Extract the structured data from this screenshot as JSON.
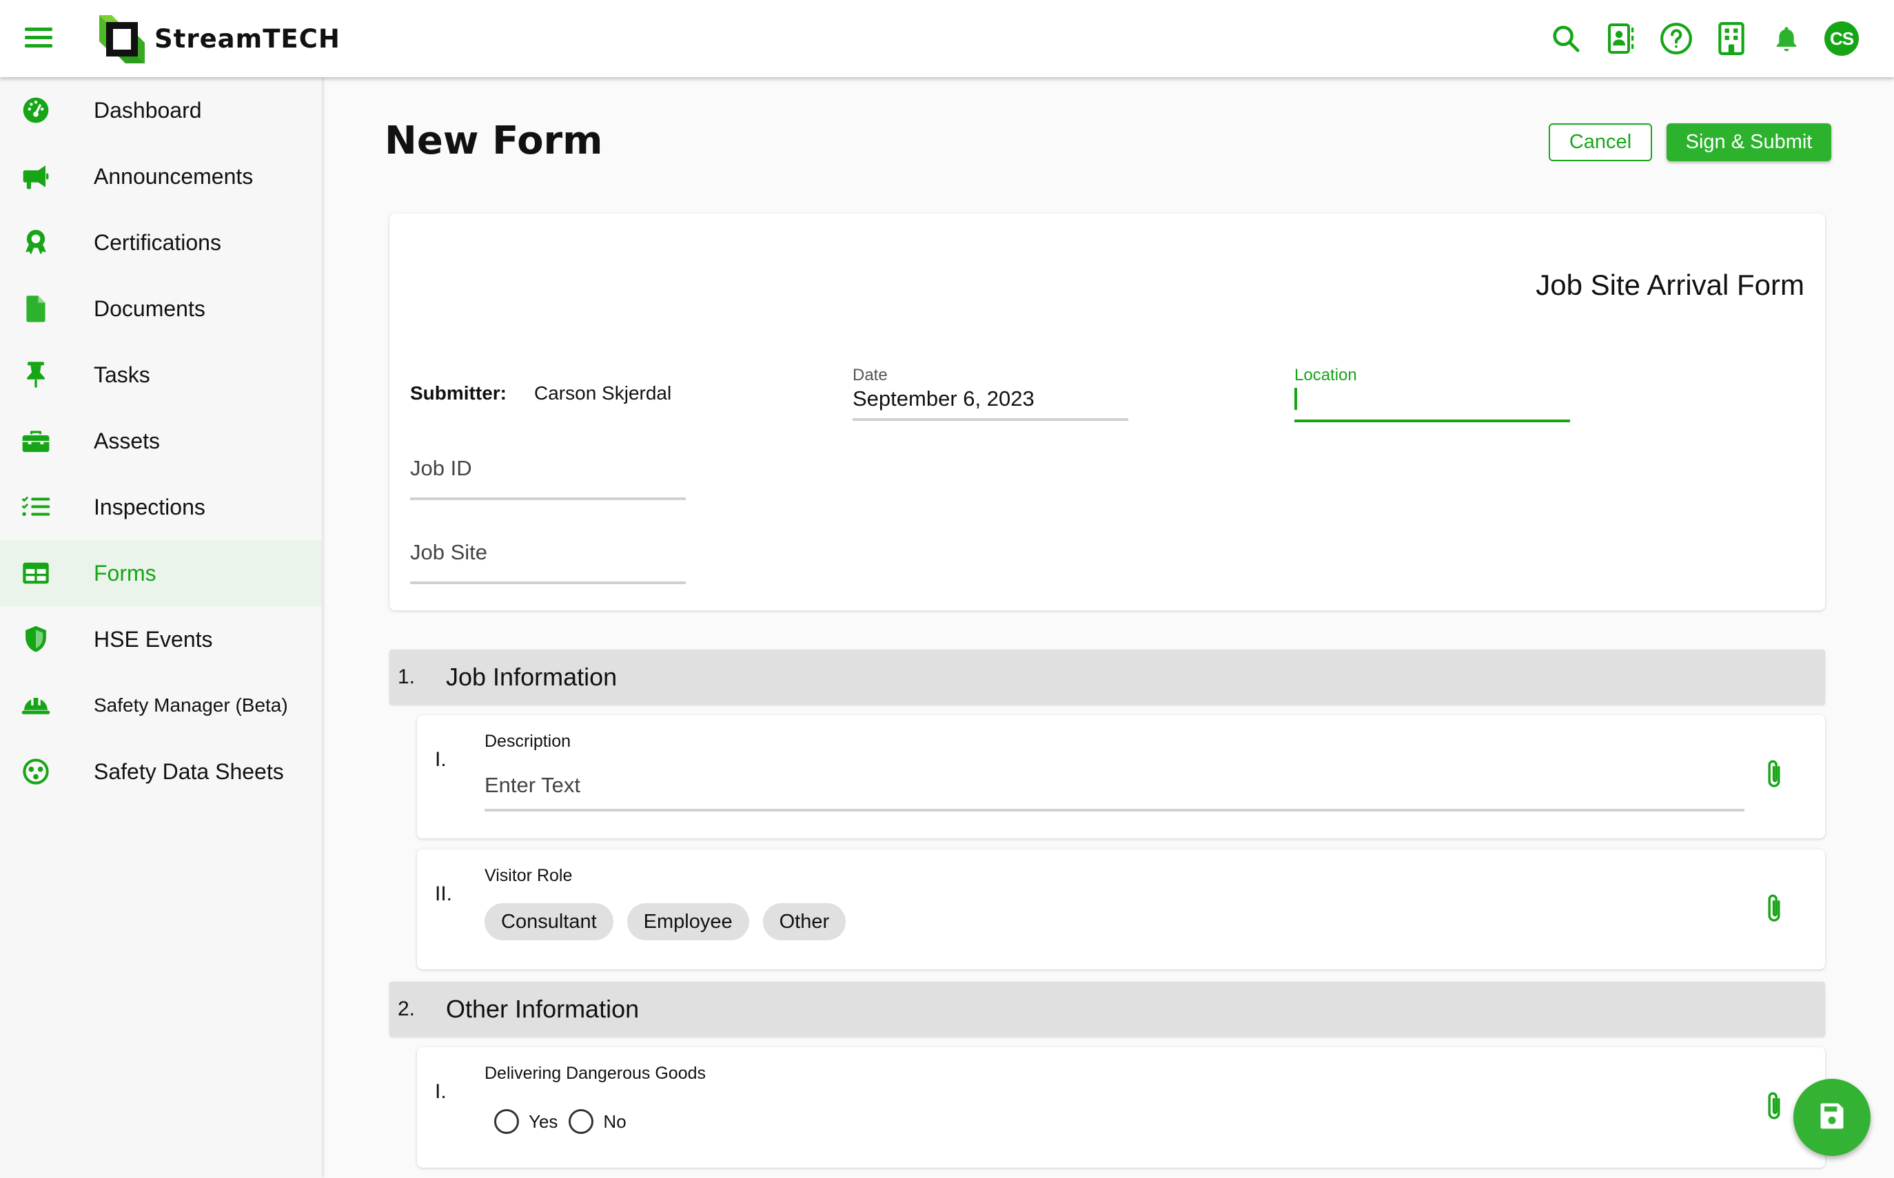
{
  "app": {
    "brand": "StreamTECH",
    "accent": "#16a516"
  },
  "header": {
    "icons": [
      "search-icon",
      "contacts-icon",
      "help-icon",
      "building-icon",
      "bell-icon"
    ],
    "avatar_initials": "CS"
  },
  "sidebar": {
    "items": [
      {
        "label": "Dashboard",
        "icon": "dashboard-icon",
        "active": false
      },
      {
        "label": "Announcements",
        "icon": "megaphone-icon",
        "active": false
      },
      {
        "label": "Certifications",
        "icon": "award-icon",
        "active": false
      },
      {
        "label": "Documents",
        "icon": "document-icon",
        "active": false
      },
      {
        "label": "Tasks",
        "icon": "pin-icon",
        "active": false
      },
      {
        "label": "Assets",
        "icon": "toolbox-icon",
        "active": false
      },
      {
        "label": "Inspections",
        "icon": "checklist-icon",
        "active": false
      },
      {
        "label": "Forms",
        "icon": "table-icon",
        "active": true
      },
      {
        "label": "HSE Events",
        "icon": "shield-icon",
        "active": false
      },
      {
        "label": "Safety Manager (Beta)",
        "icon": "hardhat-icon",
        "active": false
      },
      {
        "label": "Safety Data Sheets",
        "icon": "hazard-icon",
        "active": false
      }
    ]
  },
  "page": {
    "title": "New Form",
    "cancel_label": "Cancel",
    "submit_label": "Sign & Submit"
  },
  "form": {
    "title": "Job Site Arrival Form",
    "submitter_label": "Submitter:",
    "submitter_value": "Carson Skjerdal",
    "date_label": "Date",
    "date_value": "September 6, 2023",
    "location_label": "Location",
    "location_value": "",
    "job_id_placeholder": "Job ID",
    "job_site_placeholder": "Job Site"
  },
  "sections": [
    {
      "number": "1.",
      "title": "Job Information",
      "questions": [
        {
          "number": "I.",
          "label": "Description",
          "placeholder": "Enter Text"
        },
        {
          "number": "II.",
          "label": "Visitor Role",
          "options": [
            "Consultant",
            "Employee",
            "Other"
          ]
        }
      ]
    },
    {
      "number": "2.",
      "title": "Other Information",
      "questions": [
        {
          "number": "I.",
          "label": "Delivering Dangerous Goods",
          "options": [
            "Yes",
            "No"
          ]
        }
      ]
    }
  ],
  "fab": {
    "icon": "save-icon"
  }
}
